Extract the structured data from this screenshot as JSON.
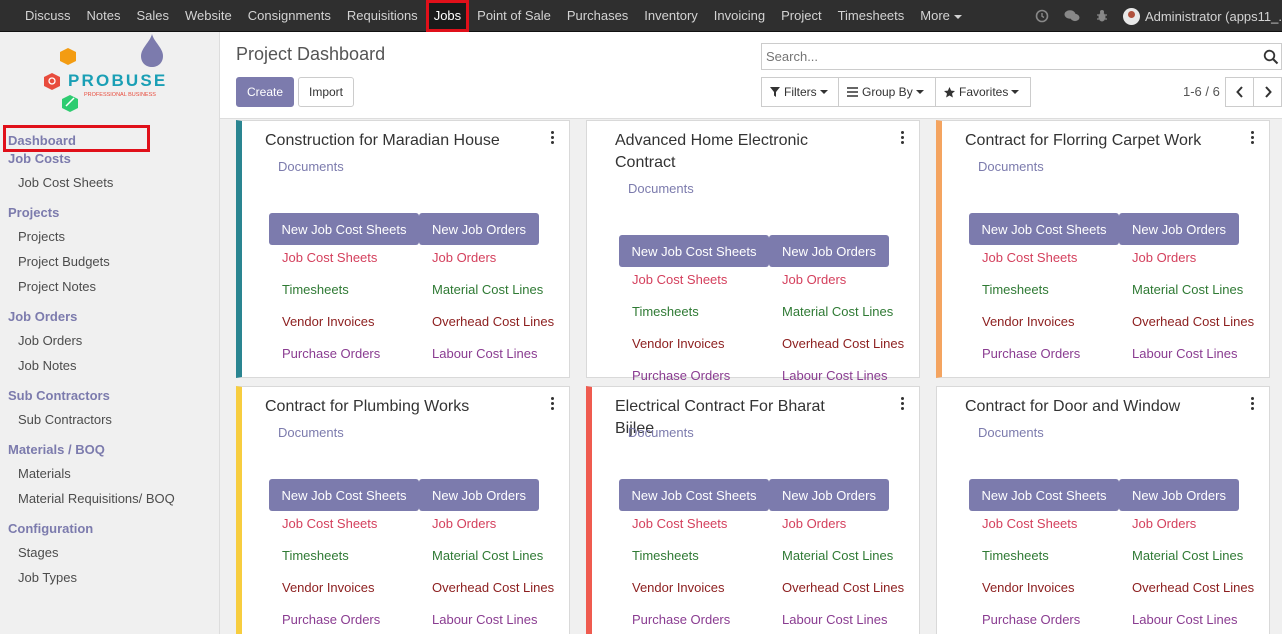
{
  "topbar": {
    "menu": [
      "Discuss",
      "Notes",
      "Sales",
      "Website",
      "Consignments",
      "Requisitions",
      "Jobs",
      "Point of Sale",
      "Purchases",
      "Inventory",
      "Invoicing",
      "Project",
      "Timesheets"
    ],
    "more_label": "More",
    "user_label": "Administrator (apps11_."
  },
  "sidebar": {
    "logo_text": "PROBUSE",
    "logo_tagline": "PROFESSIONAL BUSINESS",
    "dashboard": "Dashboard",
    "sections": [
      {
        "title": "Job Costs",
        "items": [
          "Job Cost Sheets"
        ]
      },
      {
        "title": "Projects",
        "items": [
          "Projects",
          "Project Budgets",
          "Project Notes"
        ]
      },
      {
        "title": "Job Orders",
        "items": [
          "Job Orders",
          "Job Notes"
        ]
      },
      {
        "title": "Sub Contractors",
        "items": [
          "Sub Contractors"
        ]
      },
      {
        "title": "Materials / BOQ",
        "items": [
          "Materials",
          "Material Requisitions/ BOQ"
        ]
      },
      {
        "title": "Configuration",
        "items": [
          "Stages",
          "Job Types"
        ]
      }
    ]
  },
  "control": {
    "title": "Project Dashboard",
    "create": "Create",
    "import": "Import",
    "search_placeholder": "Search...",
    "filters": "Filters",
    "group_by": "Group By",
    "favorites": "Favorites",
    "pager": "1-6 / 6"
  },
  "card_labels": {
    "documents": "Documents",
    "new_sheets": "New Job Cost Sheets",
    "new_orders": "New Job Orders",
    "job_cost_sheets": "Job Cost Sheets",
    "job_orders": "Job Orders",
    "timesheets": "Timesheets",
    "material_cost_lines": "Material Cost Lines",
    "vendor_invoices": "Vendor Invoices",
    "overhead_cost_lines": "Overhead Cost Lines",
    "purchase_orders": "Purchase Orders",
    "labour_cost_lines": "Labour Cost Lines"
  },
  "cards": [
    {
      "title": "Construction for Maradian House",
      "color": "#2a8591"
    },
    {
      "title": "Advanced Home Electronic Contract",
      "color": "#ffffff"
    },
    {
      "title": "Contract for Florring Carpet Work",
      "color": "#f4a460"
    },
    {
      "title": "Contract for Plumbing Works",
      "color": "#f7cd3f"
    },
    {
      "title": "Electrical Contract For Bharat Bijlee",
      "color": "#ef5b4f"
    },
    {
      "title": "Contract for Door and Window",
      "color": "#ffffff"
    }
  ],
  "colors": {
    "navbar": "#2f2f2f",
    "accent": "#7c7bad",
    "highlight": "#e0101a"
  }
}
